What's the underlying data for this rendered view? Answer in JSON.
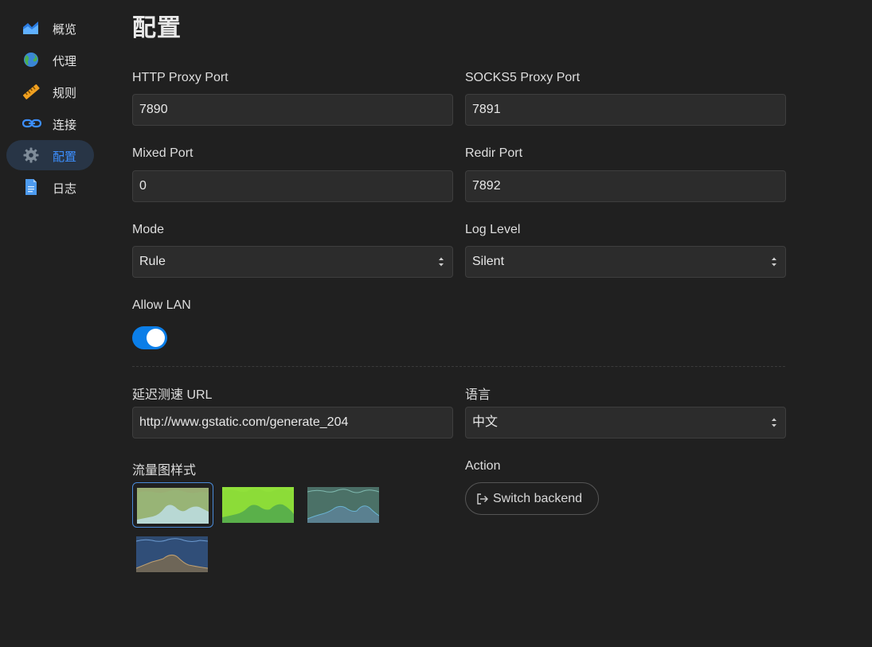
{
  "sidebar": {
    "items": [
      {
        "label": "概览",
        "icon": "chart-area-icon"
      },
      {
        "label": "代理",
        "icon": "globe-icon"
      },
      {
        "label": "规则",
        "icon": "ruler-icon"
      },
      {
        "label": "连接",
        "icon": "link-icon"
      },
      {
        "label": "配置",
        "icon": "gear-icon",
        "active": true
      },
      {
        "label": "日志",
        "icon": "document-icon"
      }
    ]
  },
  "main": {
    "title": "配置",
    "http_port": {
      "label": "HTTP Proxy Port",
      "value": "7890"
    },
    "socks_port": {
      "label": "SOCKS5 Proxy Port",
      "value": "7891"
    },
    "mixed_port": {
      "label": "Mixed Port",
      "value": "0"
    },
    "redir_port": {
      "label": "Redir Port",
      "value": "7892"
    },
    "mode": {
      "label": "Mode",
      "value": "Rule"
    },
    "log_level": {
      "label": "Log Level",
      "value": "Silent"
    },
    "allow_lan": {
      "label": "Allow LAN",
      "enabled": true
    },
    "latency_url": {
      "label": "延迟测速 URL",
      "value": "http://www.gstatic.com/generate_204"
    },
    "language": {
      "label": "语言",
      "value": "中文"
    },
    "traffic_chart_style": {
      "label": "流量图样式",
      "selected_index": 0
    },
    "action": {
      "label": "Action",
      "button_label": "Switch backend"
    }
  },
  "colors": {
    "background": "#202020",
    "accent": "#3c8fff",
    "toggle_on": "#0b7ee8"
  }
}
